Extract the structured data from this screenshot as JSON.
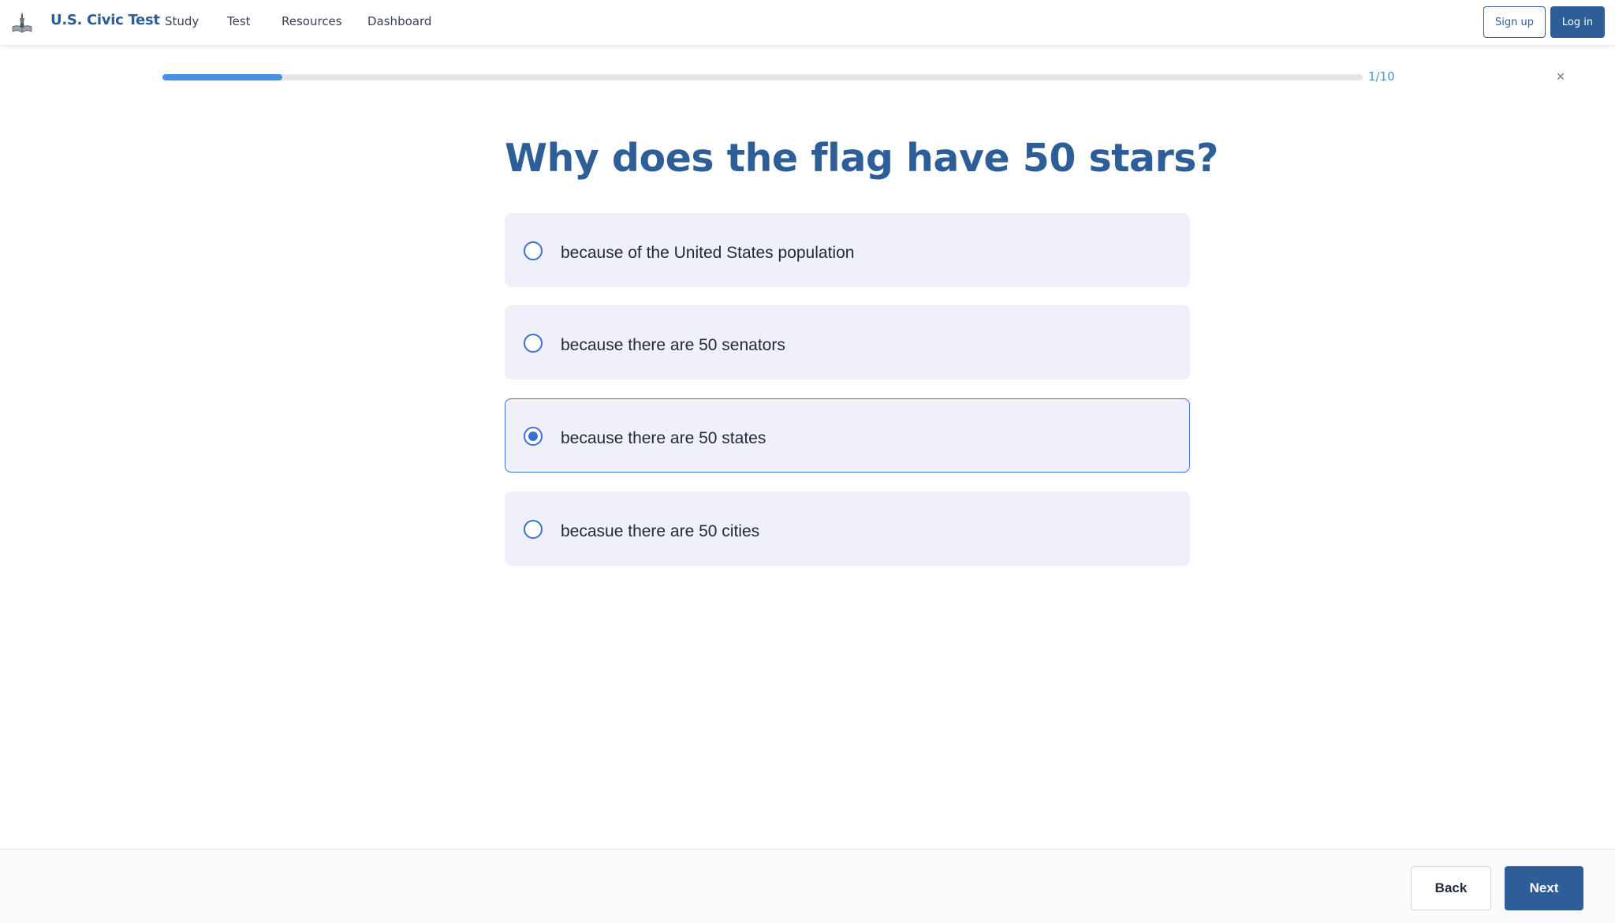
{
  "brand": {
    "name": "U.S. Civic Test",
    "logo_icon": "liberty-book-icon"
  },
  "nav": {
    "links": [
      "Study",
      "Test",
      "Resources",
      "Dashboard"
    ],
    "signup_label": "Sign up",
    "login_label": "Log in"
  },
  "progress": {
    "label": "1/10",
    "fraction": 0.1,
    "close_symbol": "×"
  },
  "question": {
    "text": "Why does the flag have 50 stars?",
    "options": [
      {
        "label": "because of the United States population",
        "selected": false
      },
      {
        "label": "because there are 50 senators",
        "selected": false
      },
      {
        "label": "because there are 50 states",
        "selected": true
      },
      {
        "label": "becasue there are 50 cities",
        "selected": false
      }
    ]
  },
  "footer": {
    "back_label": "Back",
    "next_label": "Next"
  },
  "colors": {
    "brand": "#2e5e98",
    "accent": "#4a90e2",
    "radio": "#3b6fd0",
    "option_bg": "#f0f0fa"
  }
}
